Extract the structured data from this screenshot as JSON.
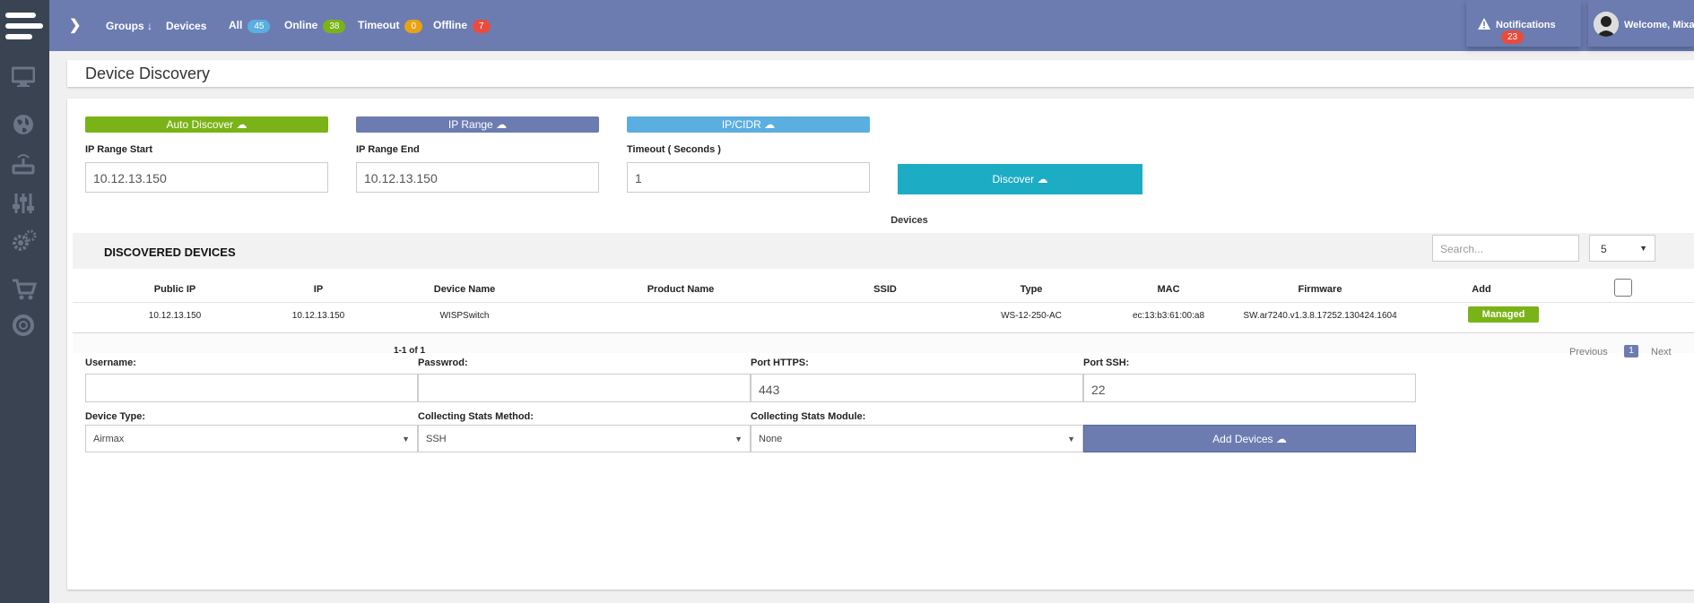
{
  "colors": {
    "topbar": "#6c7cb1",
    "sidebar": "#3a4351",
    "green": "#7ab317",
    "teal": "#1cacc4",
    "light_blue": "#5aaee0",
    "badge_blue": "#5aaee0",
    "badge_green": "#7ab317",
    "badge_yellow": "#e8a314",
    "badge_red": "#e84c3d"
  },
  "sidebar": {
    "icons": [
      "monitor-icon",
      "globe-icon",
      "router-icon",
      "sliders-icon",
      "gears-icon",
      "cart-icon",
      "lifebuoy-icon"
    ]
  },
  "topbar": {
    "groups_label": "Groups",
    "devices_label": "Devices",
    "filters": [
      {
        "label": "All",
        "count": "45"
      },
      {
        "label": "Online",
        "count": "38"
      },
      {
        "label": "Timeout",
        "count": "0"
      },
      {
        "label": "Offline",
        "count": "7"
      }
    ],
    "notifications_label": "Notifications",
    "notifications_count": "23",
    "welcome_text": "Welcome, Mixa"
  },
  "page": {
    "title": "Device Discovery"
  },
  "discovery": {
    "auto_discover_label": "Auto Discover",
    "ip_range_label": "IP Range",
    "ip_cidr_label": "IP/CIDR",
    "ip_range_start_label": "IP Range Start",
    "ip_range_start_value": "10.12.13.150",
    "ip_range_end_label": "IP Range End",
    "ip_range_end_value": "10.12.13.150",
    "timeout_label": "Timeout ( Seconds )",
    "timeout_value": "1",
    "discover_label": "Discover"
  },
  "table": {
    "caption": "Devices",
    "title": "DISCOVERED DEVICES",
    "search_placeholder": "Search...",
    "page_size": "5",
    "columns": [
      "Public IP",
      "IP",
      "Device Name",
      "Product Name",
      "SSID",
      "Type",
      "MAC",
      "Firmware",
      "Add"
    ],
    "rows": [
      {
        "public_ip": "10.12.13.150",
        "ip": "10.12.13.150",
        "device_name": "WISPSwitch",
        "product_name": "",
        "ssid": "",
        "type": "WS-12-250-AC",
        "mac": "ec:13:b3:61:00:a8",
        "firmware": "SW.ar7240.v1.3.8.17252.130424.1604",
        "status": "Managed"
      }
    ],
    "range_info": "1-1 of 1",
    "prev_label": "Previous",
    "current_page": "1",
    "next_label": "Next"
  },
  "credentials": {
    "username_label": "Username:",
    "username_value": "",
    "password_label": "Passwrod:",
    "password_value": "",
    "port_https_label": "Port HTTPS:",
    "port_https_value": "443",
    "port_ssh_label": "Port SSH:",
    "port_ssh_value": "22",
    "device_type_label": "Device Type:",
    "device_type_value": "Airmax",
    "stats_method_label": "Collecting Stats Method:",
    "stats_method_value": "SSH",
    "stats_module_label": "Collecting Stats Module:",
    "stats_module_value": "None",
    "add_devices_label": "Add Devices"
  }
}
